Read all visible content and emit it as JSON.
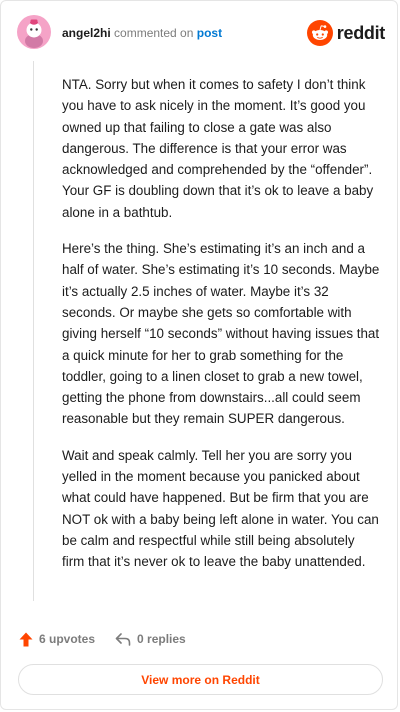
{
  "header": {
    "username": "angel2hi",
    "action_text": "commented on",
    "post_link": "post",
    "logo_text": "reddit"
  },
  "comment": {
    "paragraphs": [
      "NTA. Sorry but when it comes to safety I don’t think you have to ask nicely in the moment. It’s good you owned up that failing to close a gate was also dangerous. The difference is that your error was acknowledged and comprehended by the “offender”. Your GF is doubling down that it’s ok to leave a baby alone in a bathtub.",
      "Here’s the thing. She’s estimating it’s an inch and a half of water. She’s estimating it’s 10 seconds. Maybe it’s actually 2.5 inches of water. Maybe it’s 32 seconds. Or maybe she gets so comfortable with giving herself “10 seconds” without having issues that a quick minute for her to grab something for the toddler, going to a linen closet to grab a new towel, getting the phone from downstairs...all could seem reasonable but they remain SUPER dangerous.",
      "Wait and speak calmly. Tell her you are sorry you yelled in the moment because you panicked about what could have happened. But be firm that you are NOT ok with a baby being left alone in water. You can be calm and respectful while still being absolutely firm that it’s never ok to leave the baby unattended."
    ]
  },
  "footer": {
    "upvotes_label": "6 upvotes",
    "replies_label": "0 replies"
  },
  "view_more_label": "View more on Reddit",
  "colors": {
    "brand": "#ff4500",
    "link": "#0079d3",
    "avatar_bg": "#f5a3c7"
  }
}
